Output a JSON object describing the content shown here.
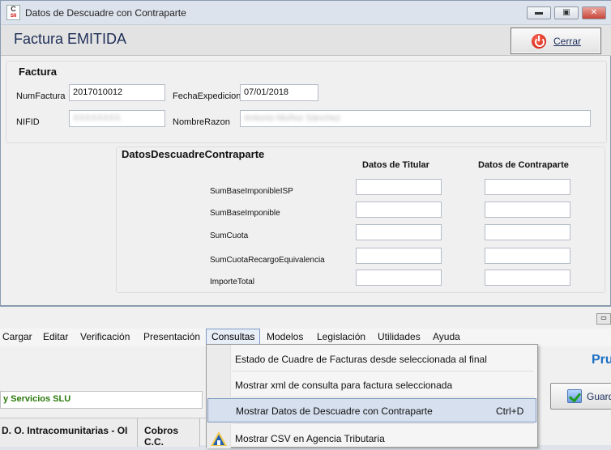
{
  "window": {
    "title": "Datos de Descuadre con Contraparte",
    "icon_label": "C",
    "icon_sub": "SII",
    "controls": [
      "minimize-icon",
      "restore-icon",
      "close-icon"
    ]
  },
  "header": {
    "title": "Factura EMITIDA",
    "close_button": "Cerrar",
    "close_button_icon": "power-icon"
  },
  "factura": {
    "group_title": "Factura",
    "num_factura_label": "NumFactura",
    "num_factura_value": "2017010012",
    "fecha_label": "FechaExpedicion",
    "fecha_value": "07/01/2018",
    "nif_label": "NIFID",
    "nif_value": "XXXXXXXX",
    "nombre_label": "NombreRazon",
    "nombre_value": "Antonio Muñoz Sánchez"
  },
  "descuadre": {
    "group_title": "DatosDescuadreContraparte",
    "col_titular": "Datos de Titular",
    "col_contraparte": "Datos de Contraparte",
    "rows": [
      {
        "label": "SumBaseImponibleISP"
      },
      {
        "label": "SumBaseImponible"
      },
      {
        "label": "SumCuota"
      },
      {
        "label": "SumCuotaRecargoEquivalencia"
      },
      {
        "label": "ImporteTotal"
      }
    ]
  },
  "menubar": {
    "items": [
      "Cargar",
      "Editar",
      "Verificación",
      "Presentación",
      "Consultas",
      "Modelos",
      "Legislación",
      "Utilidades",
      "Ayuda"
    ],
    "active": "Consultas"
  },
  "consultas_menu": {
    "items": [
      {
        "label": "Estado de Cuadre de Facturas desde seleccionada al final",
        "shortcut": ""
      },
      {
        "label": "Mostrar xml de consulta para factura seleccionada",
        "shortcut": ""
      },
      {
        "label": "Mostrar Datos de Descuadre con Contraparte",
        "shortcut": "Ctrl+D",
        "highlighted": true
      },
      {
        "label": "Mostrar CSV en Agencia Tributaria",
        "shortcut": "",
        "icon": "aeat-icon"
      }
    ]
  },
  "background_app": {
    "brand_fragment": "Pru",
    "company_name": "y Servicios SLU",
    "save_button": "Guarda",
    "tabs": [
      "D. O. Intracomunitarias - OI",
      "Cobros C.C."
    ]
  },
  "colors": {
    "title_blue": "#1e2f58",
    "accent_blue": "#1b6fc4",
    "company_green": "#2b7a0b",
    "highlight": "#d6e0ee"
  }
}
